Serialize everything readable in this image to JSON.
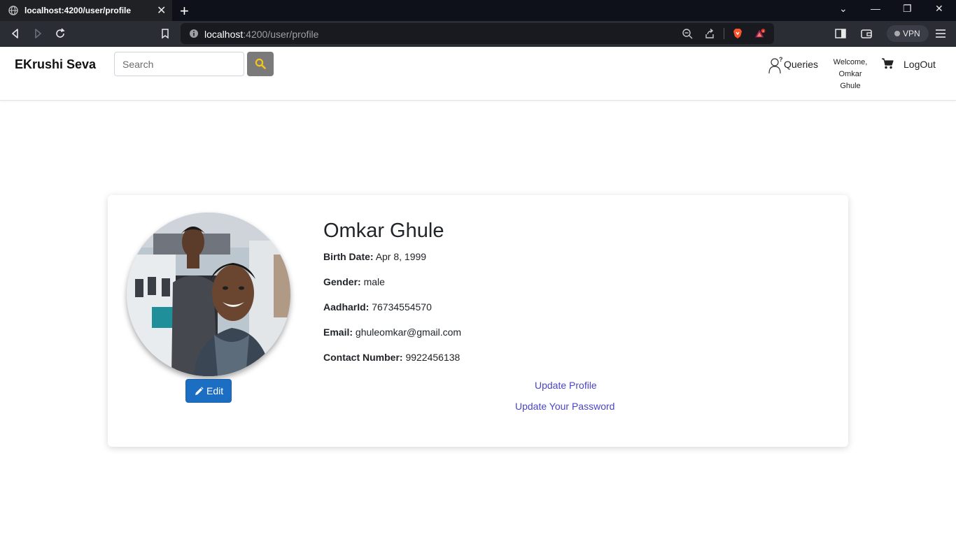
{
  "browser": {
    "tab_title": "localhost:4200/user/profile",
    "url_host": "localhost",
    "url_rest": ":4200/user/profile",
    "vpn_label": "VPN",
    "alert_badge": "1"
  },
  "navbar": {
    "brand": "EKrushi Seva",
    "search_placeholder": "Search",
    "queries_label": "Queries",
    "welcome_line1": "Welcome,",
    "welcome_line2": "Omkar Ghule",
    "logout_label": "LogOut"
  },
  "profile": {
    "name": "Omkar Ghule",
    "birth_date_label": "Birth Date:",
    "birth_date": "Apr 8, 1999",
    "gender_label": "Gender:",
    "gender": "male",
    "aadhar_label": "AadharId:",
    "aadhar": "76734554570",
    "email_label": "Email:",
    "email": "ghuleomkar@gmail.com",
    "contact_label": "Contact Number:",
    "contact": "9922456138",
    "edit_label": "Edit",
    "update_profile_label": "Update Profile",
    "update_password_label": "Update Your Password"
  },
  "colors": {
    "brand_button": "#1b6ec2",
    "link": "#4a45c4",
    "search_button": "#7a7a7a"
  },
  "icons": [
    "globe-icon",
    "close-icon",
    "plus-icon",
    "back-icon",
    "forward-icon",
    "reload-icon",
    "bookmark-icon",
    "info-icon",
    "zoom-icon",
    "share-icon",
    "brave-shield-icon",
    "brave-rewards-icon",
    "sidebar-icon",
    "wallet-icon",
    "menu-icon",
    "search-icon",
    "question-person-icon",
    "cart-icon",
    "pencil-icon"
  ]
}
